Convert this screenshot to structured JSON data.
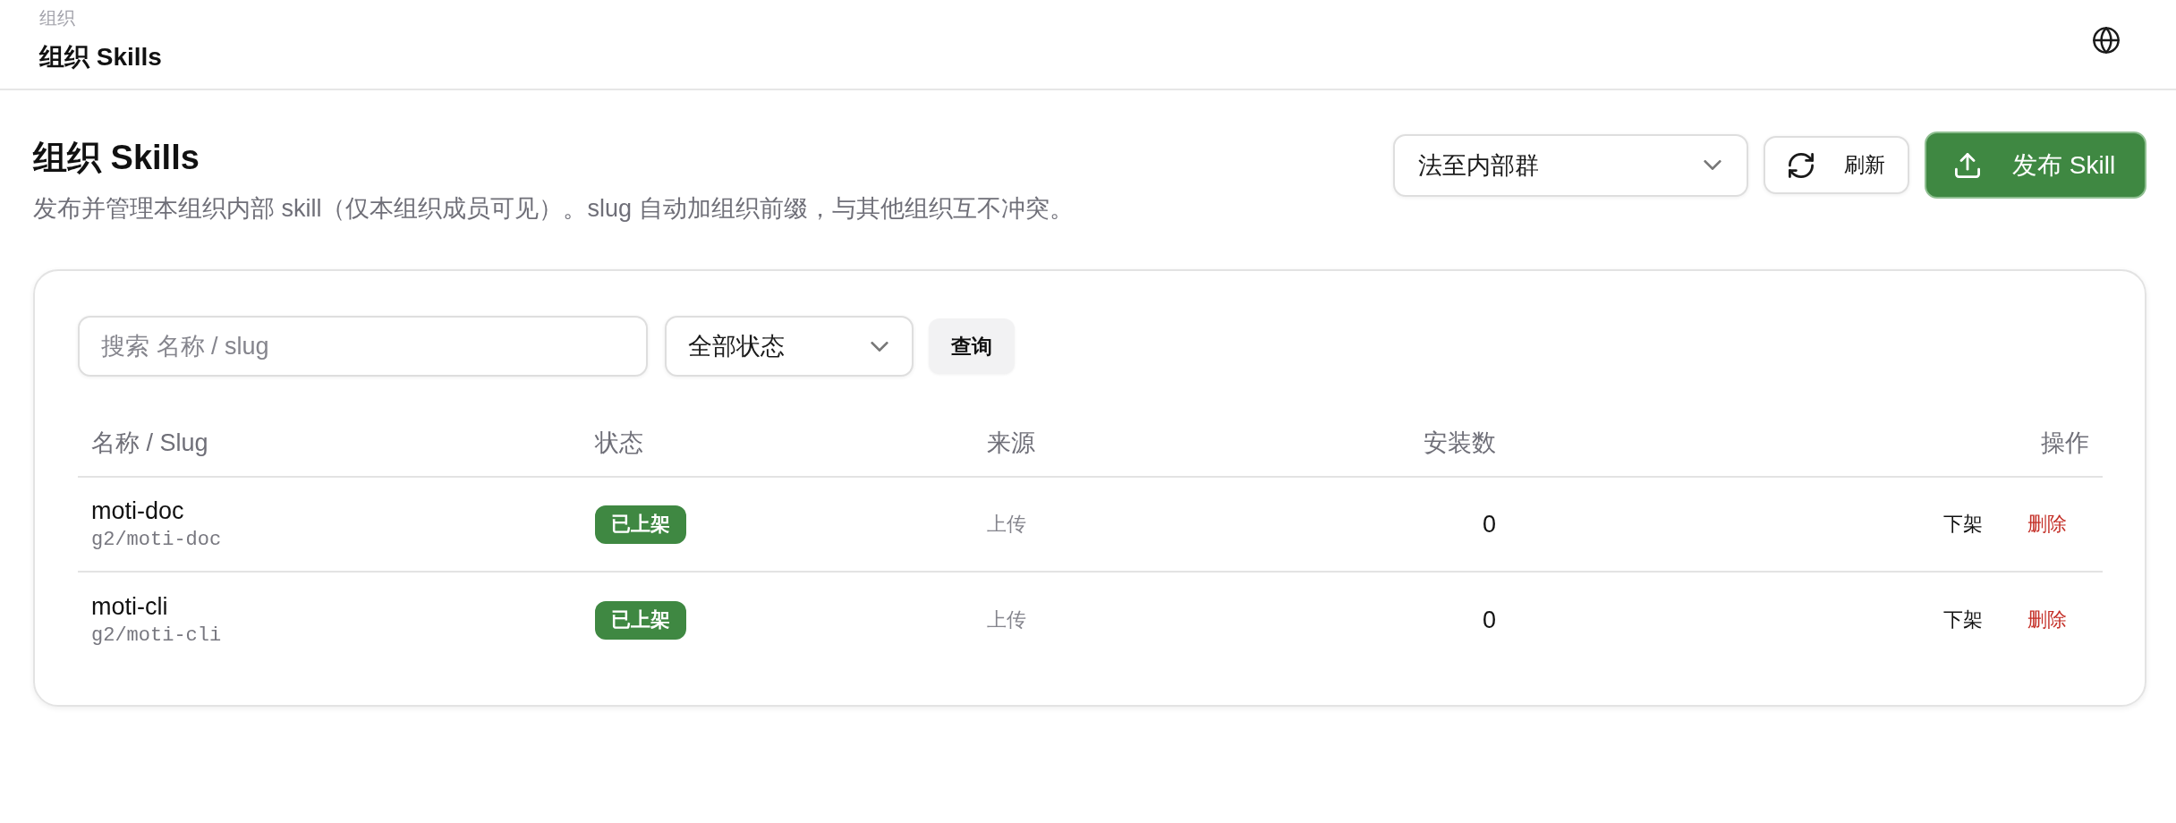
{
  "header": {
    "breadcrumb": "组织",
    "title": "组织 Skills"
  },
  "page": {
    "title": "组织 Skills",
    "description": "发布并管理本组织内部 skill（仅本组织成员可见）。slug 自动加组织前缀，与其他组织互不冲突。"
  },
  "toolbar": {
    "org_select": {
      "value": "法至内部群"
    },
    "refresh_button": "刷新",
    "publish_button": "发布 Skill"
  },
  "filters": {
    "search": {
      "placeholder": "搜索 名称 / slug"
    },
    "status_select": {
      "value": "全部状态"
    },
    "query_button": "查询"
  },
  "table": {
    "columns": [
      "名称 / Slug",
      "状态",
      "来源",
      "安装数",
      "操作"
    ],
    "rows": [
      {
        "name": "moti-doc",
        "slug": "g2/moti-doc",
        "status": {
          "label": "已上架",
          "kind": "published"
        },
        "source": "上传",
        "installs": "0",
        "actions": [
          {
            "label": "下架",
            "kind": "default"
          },
          {
            "label": "删除",
            "kind": "danger"
          }
        ]
      },
      {
        "name": "moti-cli",
        "slug": "g2/moti-cli",
        "status": {
          "label": "已上架",
          "kind": "published"
        },
        "source": "上传",
        "installs": "0",
        "actions": [
          {
            "label": "下架",
            "kind": "default"
          },
          {
            "label": "删除",
            "kind": "danger"
          }
        ]
      }
    ]
  }
}
